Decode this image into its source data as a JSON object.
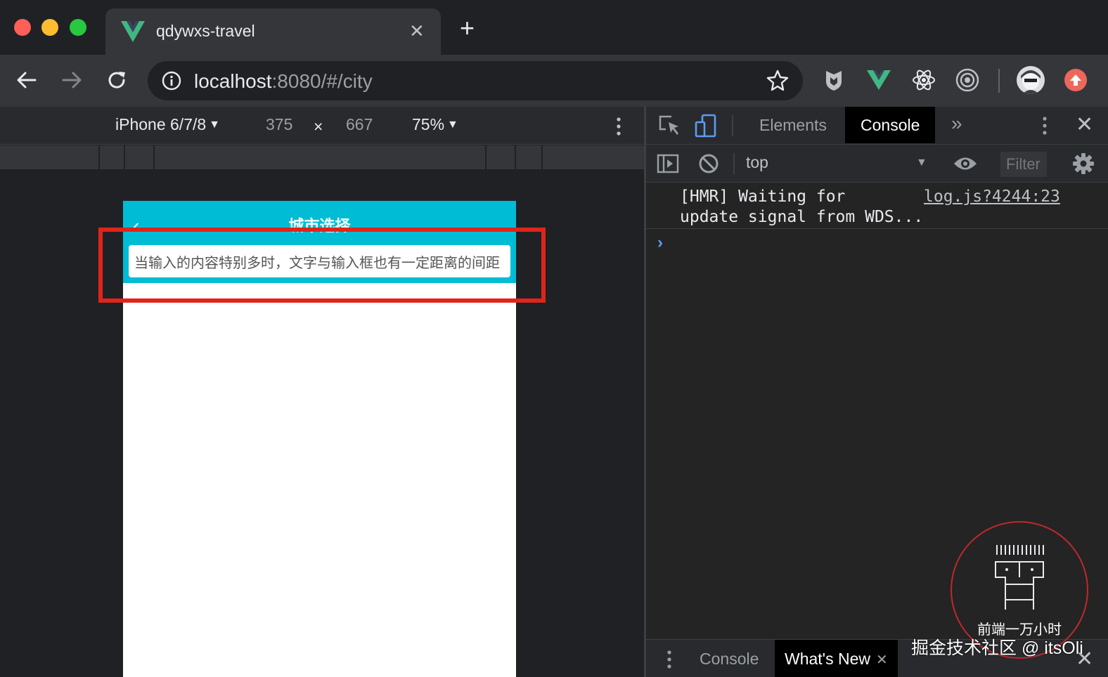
{
  "browser": {
    "tab": {
      "title": "qdywxs-travel"
    },
    "new_tab": "+",
    "address": {
      "host": "localhost",
      "rest": ":8080/#/city"
    }
  },
  "device_toolbar": {
    "device": "iPhone 6/7/8",
    "width": "375",
    "times": "×",
    "height": "667",
    "zoom": "75%"
  },
  "page": {
    "title": "城市选择",
    "back_icon": "chevron-left-icon",
    "search_value": "当输入的内容特别多时，文字与输入框也有一定距离的间距"
  },
  "devtools": {
    "tabs": [
      "Elements",
      "Console"
    ],
    "active_tab": "Console",
    "context": "top",
    "filter_placeholder": "Filter",
    "log": {
      "message": "[HMR] Waiting for\nupdate signal from WDS...",
      "source": "log.js?4244:23"
    },
    "prompt": "›",
    "drawer": {
      "tabs": [
        "Console",
        "What's New"
      ],
      "active": "What's New"
    }
  },
  "watermark": {
    "brand": "前端一万小时",
    "text": "掘金技术社区 @ itsOli"
  },
  "colors": {
    "accent": "#00bcd4",
    "highlight": "#e0241b",
    "link": "#5b9cf5"
  }
}
